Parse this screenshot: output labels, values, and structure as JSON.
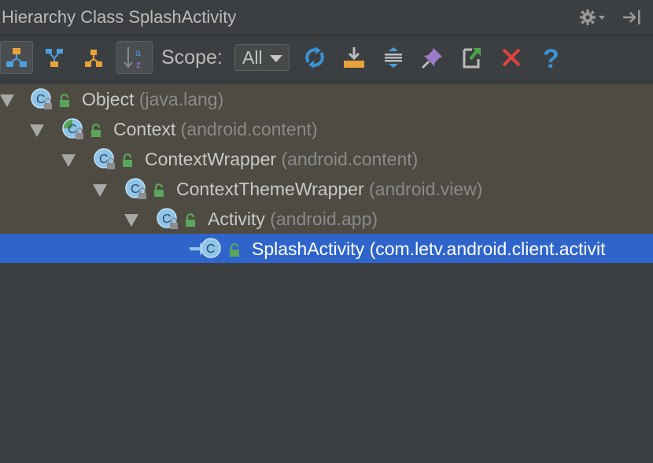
{
  "title": "Hierarchy Class SplashActivity",
  "toolbar": {
    "scope_label": "Scope:",
    "scope_value": "All"
  },
  "tree": [
    {
      "name": "Object",
      "pkg": "(java.lang)"
    },
    {
      "name": "Context",
      "pkg": "(android.content)"
    },
    {
      "name": "ContextWrapper",
      "pkg": "(android.content)"
    },
    {
      "name": "ContextThemeWrapper",
      "pkg": "(android.view)"
    },
    {
      "name": "Activity",
      "pkg": "(android.app)"
    },
    {
      "name": "SplashActivity",
      "pkg": "(com.letv.android.client.activit"
    }
  ],
  "colors": {
    "background": "#3c3f41",
    "tree_row": "#4e4b43",
    "selection": "#2f65ca",
    "class_icon": "#8fc3e8",
    "lock": "#5aa55a",
    "refresh": "#3a93d6",
    "close": "#e0443f",
    "help": "#3a93d6"
  },
  "icons": {
    "settings": "gear-icon",
    "hide": "hide-panel-icon",
    "supertypes": "supertypes-hierarchy-icon",
    "subtypes": "subtypes-hierarchy-icon",
    "class_hierarchy": "class-hierarchy-icon",
    "sort": "sort-alphabetically-icon",
    "refresh": "refresh-icon",
    "export": "export-icon",
    "expand_all": "expand-all-icon",
    "pin": "pin-icon",
    "export_to_file": "export-to-file-icon",
    "close": "close-icon",
    "help": "help-icon"
  }
}
